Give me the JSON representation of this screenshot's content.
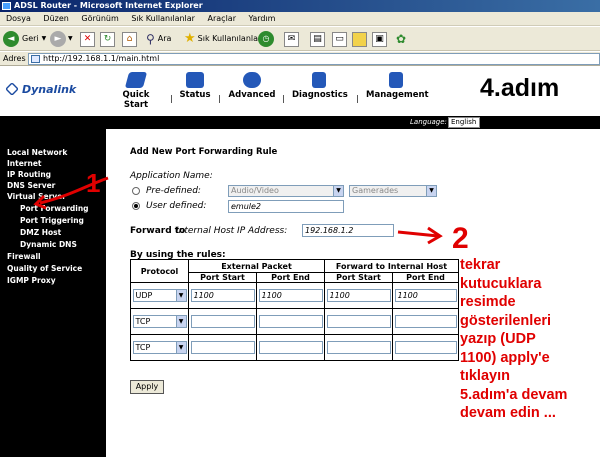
{
  "window": {
    "title": "ADSL Router - Microsoft Internet Explorer"
  },
  "menu": [
    "Dosya",
    "Düzen",
    "Görünüm",
    "Sık Kullanılanlar",
    "Araçlar",
    "Yardım"
  ],
  "toolbar": {
    "back": "Geri",
    "search": "Ara",
    "favorites": "Sık Kullanılanlar"
  },
  "address": {
    "label": "Adres",
    "url": "http://192.168.1.1/main.html"
  },
  "brand": {
    "logo": "Dynalink"
  },
  "nav": [
    {
      "label": "Quick Start"
    },
    {
      "label": "Status"
    },
    {
      "label": "Advanced"
    },
    {
      "label": "Diagnostics"
    },
    {
      "label": "Management"
    }
  ],
  "nav_sep": "|",
  "annotation_step4": "4.adım",
  "language": {
    "label": "Language:",
    "value": "English"
  },
  "sidebar": [
    "Local Network",
    "Internet",
    "IP Routing",
    "DNS Server",
    "Virtual Server",
    "Port Forwarding",
    "Port Triggering",
    "DMZ Host",
    "Dynamic DNS",
    "Firewall",
    "Quality of Service",
    "IGMP Proxy"
  ],
  "form": {
    "title": "Add New Port Forwarding Rule",
    "app_name_label": "Application Name:",
    "predefined_label": "Pre-defined:",
    "predefined_select": "Audio/Video",
    "predefined_select2": "Gamerades",
    "user_defined_label": "User defined:",
    "user_defined_value": "emule2",
    "forward_label": "Forward to",
    "forward_label_it": "Internal Host IP Address:",
    "forward_value": "192.168.1.2",
    "rules_label": "By using the rules:",
    "col_protocol": "Protocol",
    "col_external": "External Packet",
    "col_internal": "Forward to Internal Host",
    "col_port_start": "Port Start",
    "col_port_end": "Port End",
    "rows": [
      {
        "protocol": "UDP",
        "ext_start": "1100",
        "ext_end": "1100",
        "int_start": "1100",
        "int_end": "1100"
      },
      {
        "protocol": "TCP",
        "ext_start": "",
        "ext_end": "",
        "int_start": "",
        "int_end": ""
      },
      {
        "protocol": "TCP",
        "ext_start": "",
        "ext_end": "",
        "int_start": "",
        "int_end": ""
      }
    ],
    "apply": "Apply"
  },
  "annotations": {
    "num1": "1",
    "num2": "2",
    "note": [
      "tekrar",
      "kutucuklara",
      "resimde",
      "gösterilenleri",
      "yazıp (UDP",
      "1100) apply'e",
      "tıklayın",
      "5.adım'a devam",
      "devam edin ..."
    ]
  },
  "colors": {
    "sidebar_bg": "#000000",
    "annotation_red": "#e00000",
    "nav_icon": "#2458b8"
  }
}
